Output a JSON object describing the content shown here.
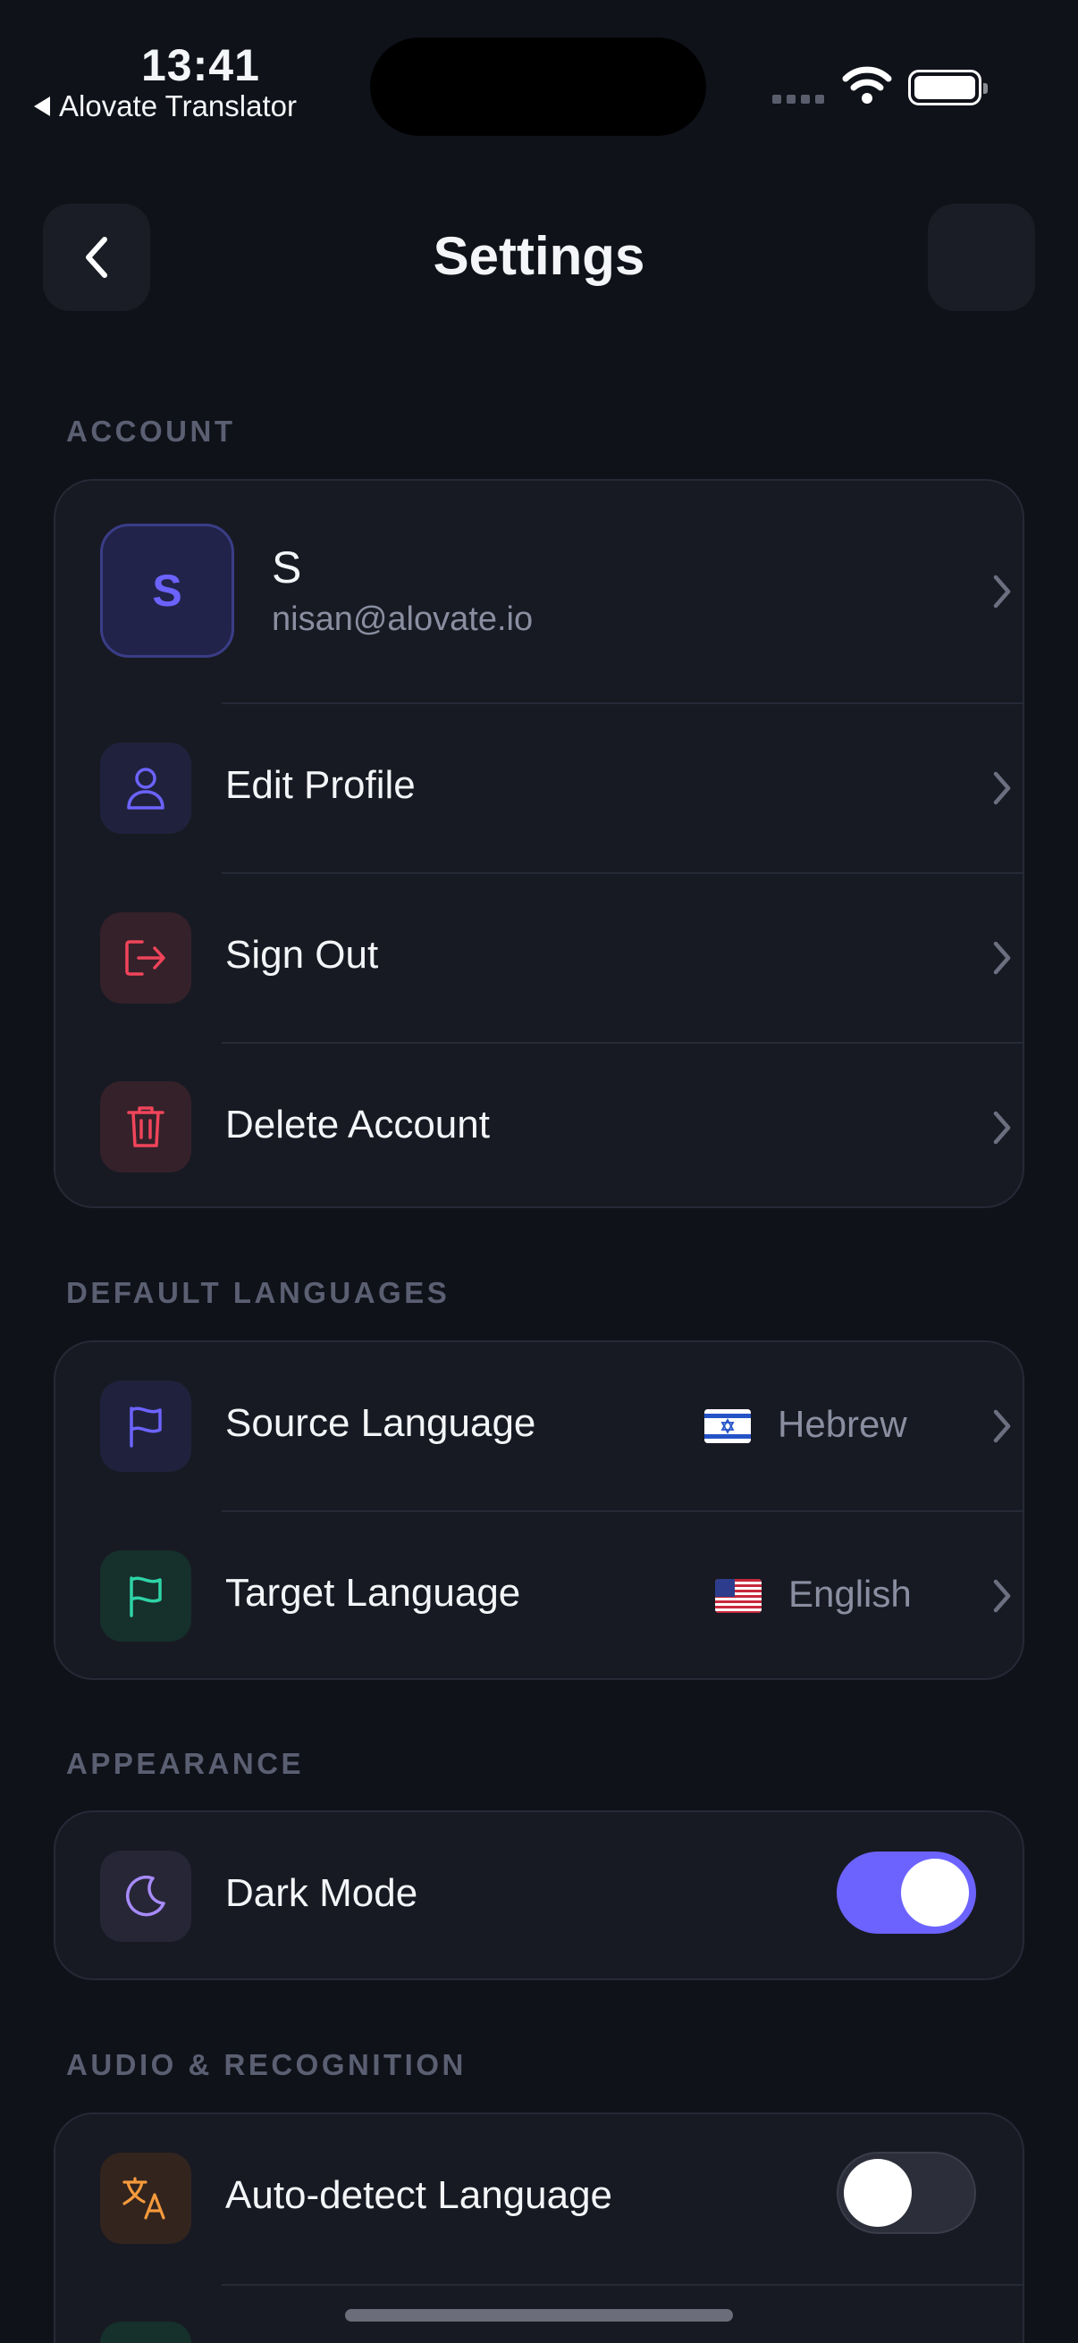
{
  "status_bar": {
    "time": "13:41",
    "back_app": "Alovate Translator",
    "icons": [
      "signal-icon",
      "wifi-icon",
      "battery-icon"
    ]
  },
  "header": {
    "title": "Settings",
    "back_icon": "chevron-left-icon"
  },
  "colors": {
    "background": "#10121a",
    "card": "#181a23",
    "accent": "#6c63ff",
    "danger": "#f0445a",
    "teal": "#2ed3a6",
    "orange": "#f59a3c"
  },
  "sections": {
    "account": {
      "label": "ACCOUNT",
      "profile": {
        "avatar_initial": "S",
        "name": "S",
        "email": "nisan@alovate.io"
      },
      "items": [
        {
          "label": "Edit Profile",
          "icon": "user-icon"
        },
        {
          "label": "Sign Out",
          "icon": "sign-out-icon"
        },
        {
          "label": "Delete Account",
          "icon": "trash-icon"
        }
      ]
    },
    "languages": {
      "label": "DEFAULT LANGUAGES",
      "items": [
        {
          "label": "Source Language",
          "value": "Hebrew",
          "flag": "israel-flag-icon",
          "icon": "flag-icon"
        },
        {
          "label": "Target Language",
          "value": "English",
          "flag": "us-flag-icon",
          "icon": "flag-icon"
        }
      ]
    },
    "appearance": {
      "label": "APPEARANCE",
      "items": [
        {
          "label": "Dark Mode",
          "icon": "moon-icon",
          "enabled": true
        }
      ]
    },
    "audio": {
      "label": "AUDIO & RECOGNITION",
      "items": [
        {
          "label": "Auto-detect Language",
          "icon": "translate-icon",
          "enabled": false
        }
      ]
    }
  }
}
